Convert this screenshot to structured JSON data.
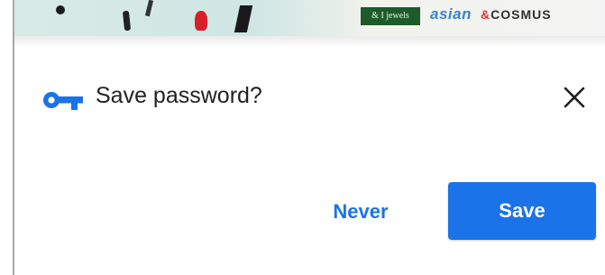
{
  "banner": {
    "logos": {
      "jewels": "& I jewels",
      "asian": "asian",
      "cosmus_amp": "&",
      "cosmus": "COSMUS"
    }
  },
  "dialog": {
    "title": "Save password?",
    "never_label": "Never",
    "save_label": "Save",
    "icons": {
      "leading": "key-icon",
      "dismiss": "close-icon"
    },
    "colors": {
      "accent": "#1a73e8",
      "text": "#202124",
      "button_text": "#ffffff"
    }
  }
}
